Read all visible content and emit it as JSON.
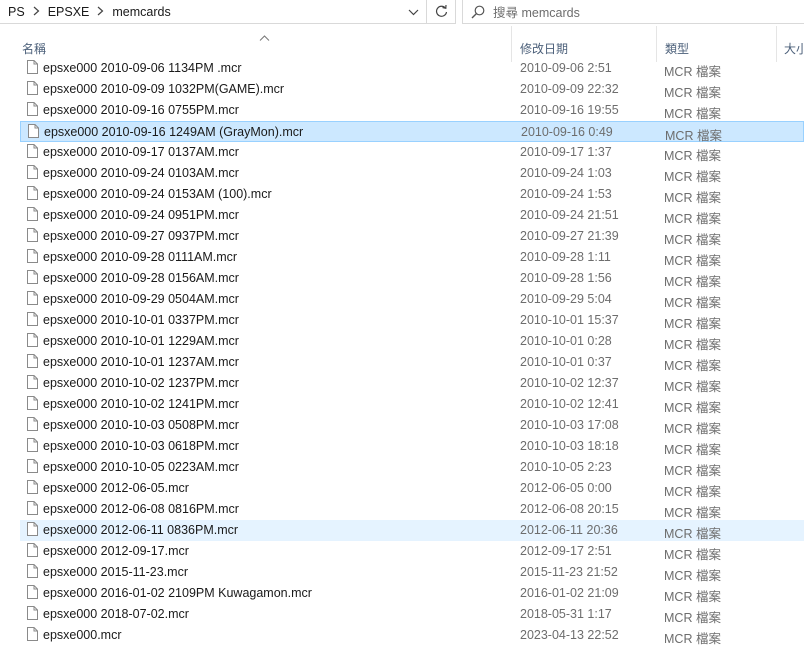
{
  "address": {
    "crumbs": [
      "PS",
      "EPSXE",
      "memcards"
    ]
  },
  "search": {
    "placeholder": "搜尋 memcards"
  },
  "columns": {
    "name": "名稱",
    "date": "修改日期",
    "type": "類型",
    "size": "大小"
  },
  "files": [
    {
      "name": "epsxe000 2010-09-06 1134PM .mcr",
      "date": "2010-09-06 2:51",
      "type": "MCR 檔案"
    },
    {
      "name": "epsxe000 2010-09-09 1032PM(GAME).mcr",
      "date": "2010-09-09 22:32",
      "type": "MCR 檔案"
    },
    {
      "name": "epsxe000 2010-09-16 0755PM.mcr",
      "date": "2010-09-16 19:55",
      "type": "MCR 檔案"
    },
    {
      "name": "epsxe000 2010-09-16 1249AM (GrayMon).mcr",
      "date": "2010-09-16 0:49",
      "type": "MCR 檔案",
      "state": "selected"
    },
    {
      "name": "epsxe000 2010-09-17 0137AM.mcr",
      "date": "2010-09-17 1:37",
      "type": "MCR 檔案"
    },
    {
      "name": "epsxe000 2010-09-24 0103AM.mcr",
      "date": "2010-09-24 1:03",
      "type": "MCR 檔案"
    },
    {
      "name": "epsxe000 2010-09-24 0153AM (100).mcr",
      "date": "2010-09-24 1:53",
      "type": "MCR 檔案"
    },
    {
      "name": "epsxe000 2010-09-24 0951PM.mcr",
      "date": "2010-09-24 21:51",
      "type": "MCR 檔案"
    },
    {
      "name": "epsxe000 2010-09-27 0937PM.mcr",
      "date": "2010-09-27 21:39",
      "type": "MCR 檔案"
    },
    {
      "name": "epsxe000 2010-09-28 0111AM.mcr",
      "date": "2010-09-28 1:11",
      "type": "MCR 檔案"
    },
    {
      "name": "epsxe000 2010-09-28 0156AM.mcr",
      "date": "2010-09-28 1:56",
      "type": "MCR 檔案"
    },
    {
      "name": "epsxe000 2010-09-29 0504AM.mcr",
      "date": "2010-09-29 5:04",
      "type": "MCR 檔案"
    },
    {
      "name": "epsxe000 2010-10-01 0337PM.mcr",
      "date": "2010-10-01 15:37",
      "type": "MCR 檔案"
    },
    {
      "name": "epsxe000 2010-10-01 1229AM.mcr",
      "date": "2010-10-01 0:28",
      "type": "MCR 檔案"
    },
    {
      "name": "epsxe000 2010-10-01 1237AM.mcr",
      "date": "2010-10-01 0:37",
      "type": "MCR 檔案"
    },
    {
      "name": "epsxe000 2010-10-02 1237PM.mcr",
      "date": "2010-10-02 12:37",
      "type": "MCR 檔案"
    },
    {
      "name": "epsxe000 2010-10-02 1241PM.mcr",
      "date": "2010-10-02 12:41",
      "type": "MCR 檔案"
    },
    {
      "name": "epsxe000 2010-10-03 0508PM.mcr",
      "date": "2010-10-03 17:08",
      "type": "MCR 檔案"
    },
    {
      "name": "epsxe000 2010-10-03 0618PM.mcr",
      "date": "2010-10-03 18:18",
      "type": "MCR 檔案"
    },
    {
      "name": "epsxe000 2010-10-05 0223AM.mcr",
      "date": "2010-10-05 2:23",
      "type": "MCR 檔案"
    },
    {
      "name": "epsxe000 2012-06-05.mcr",
      "date": "2012-06-05 0:00",
      "type": "MCR 檔案"
    },
    {
      "name": "epsxe000 2012-06-08 0816PM.mcr",
      "date": "2012-06-08 20:15",
      "type": "MCR 檔案"
    },
    {
      "name": "epsxe000 2012-06-11 0836PM.mcr",
      "date": "2012-06-11 20:36",
      "type": "MCR 檔案",
      "state": "hover"
    },
    {
      "name": "epsxe000 2012-09-17.mcr",
      "date": "2012-09-17 2:51",
      "type": "MCR 檔案"
    },
    {
      "name": "epsxe000 2015-11-23.mcr",
      "date": "2015-11-23 21:52",
      "type": "MCR 檔案"
    },
    {
      "name": "epsxe000 2016-01-02 2109PM Kuwagamon.mcr",
      "date": "2016-01-02 21:09",
      "type": "MCR 檔案"
    },
    {
      "name": "epsxe000 2018-07-02.mcr",
      "date": "2018-05-31 1:17",
      "type": "MCR 檔案"
    },
    {
      "name": "epsxe000.mcr",
      "date": "2023-04-13 22:52",
      "type": "MCR 檔案"
    }
  ],
  "icons": {
    "breadcrumb_separator": "chevron-right-icon",
    "address_dropdown": "chevron-down-icon",
    "refresh": "refresh-icon",
    "search": "search-icon",
    "sort": "sort-up-icon",
    "file": "file-icon"
  },
  "colors": {
    "selected_bg": "#cce8ff",
    "selected_border": "#99d1ff",
    "hover_bg": "#e5f3ff",
    "header_text": "#4c607a",
    "secondary_text": "#6d6d6d"
  }
}
